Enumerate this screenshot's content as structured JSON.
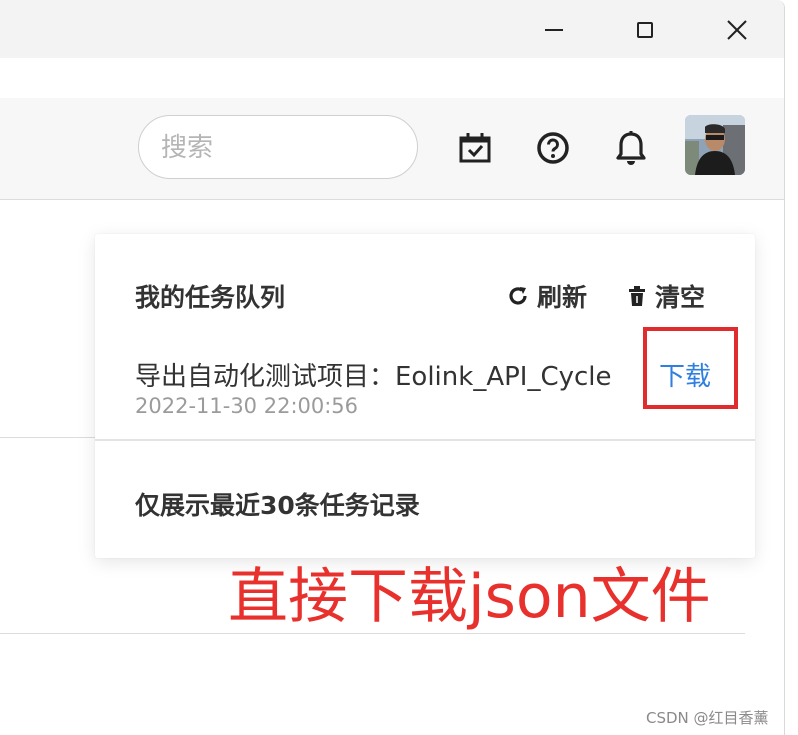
{
  "window": {
    "controls": [
      "minimize-icon",
      "maximize-icon",
      "close-icon"
    ]
  },
  "header": {
    "search_placeholder": "搜索",
    "icons": [
      "calendar-check-icon",
      "help-circle-icon",
      "bell-icon"
    ],
    "avatar": "user-avatar"
  },
  "task_popup": {
    "title": "我的任务队列",
    "refresh_label": "刷新",
    "clear_label": "清空",
    "task": {
      "name": "导出自动化测试项目：Eolink_API_Cycle",
      "time": "2022-11-30 22:00:56",
      "download_label": "下载"
    },
    "footer": "仅展示最近30条任务记录"
  },
  "annotation": "直接下载json文件",
  "watermark": "CSDN @红目香薰",
  "colors": {
    "link": "#2f7fe0",
    "annotation": "#e8302c",
    "highlight": "#e02c2c"
  }
}
